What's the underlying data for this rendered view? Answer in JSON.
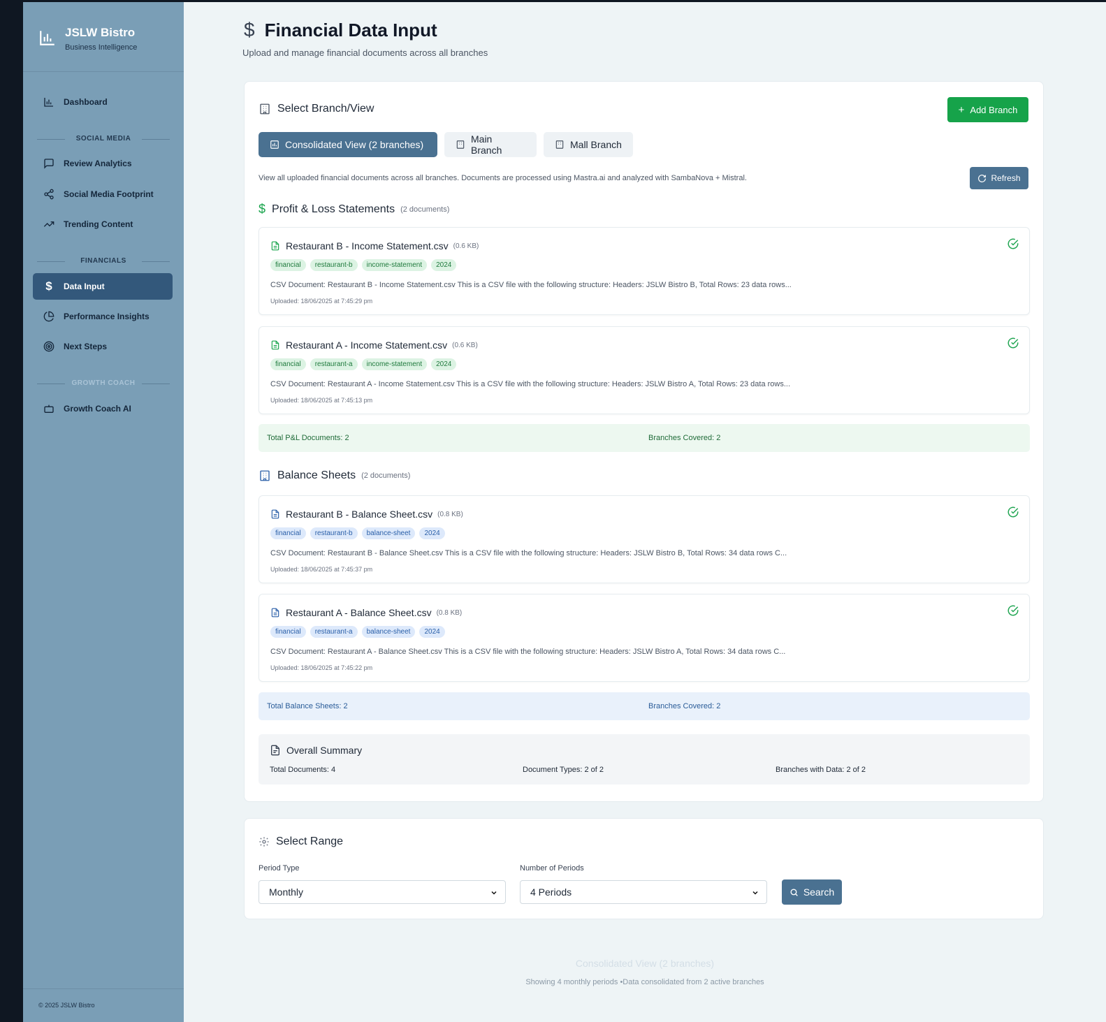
{
  "brand": {
    "title": "JSLW Bistro",
    "subtitle": "Business Intelligence"
  },
  "sidebar": {
    "dashboard": "Dashboard",
    "section_social": "SOCIAL MEDIA",
    "review_analytics": "Review Analytics",
    "social_footprint": "Social Media Footprint",
    "trending_content": "Trending Content",
    "section_financials": "FINANCIALS",
    "data_input": "Data Input",
    "performance_insights": "Performance Insights",
    "next_steps": "Next Steps",
    "section_growth": "GROWTH COACH",
    "growth_coach": "Growth Coach AI",
    "footer": "© 2025 JSLW Bistro"
  },
  "header": {
    "title": "Financial Data Input",
    "subtitle": "Upload and manage financial documents across all branches"
  },
  "branch": {
    "heading": "Select Branch/View",
    "add_button": "Add Branch",
    "tabs": [
      "Consolidated View (2 branches)",
      "Main Branch",
      "Mall Branch"
    ],
    "description": "View all uploaded financial documents across all branches. Documents are processed using Mastra.ai and analyzed with SambaNova + Mistral.",
    "refresh": "Refresh"
  },
  "pl": {
    "heading": "Profit & Loss Statements",
    "count": "(2 documents)",
    "docs": [
      {
        "name": "Restaurant B - Income Statement.csv",
        "size": "(0.6 KB)",
        "tags": [
          "financial",
          "restaurant-b",
          "income-statement",
          "2024"
        ],
        "desc": "CSV Document: Restaurant B - Income Statement.csv This is a CSV file with the following structure: Headers: JSLW Bistro B, Total Rows: 23 data rows...",
        "uploaded": "Uploaded: 18/06/2025 at 7:45:29 pm"
      },
      {
        "name": "Restaurant A - Income Statement.csv",
        "size": "(0.6 KB)",
        "tags": [
          "financial",
          "restaurant-a",
          "income-statement",
          "2024"
        ],
        "desc": "CSV Document: Restaurant A - Income Statement.csv This is a CSV file with the following structure: Headers: JSLW Bistro A, Total Rows: 23 data rows...",
        "uploaded": "Uploaded: 18/06/2025 at 7:45:13 pm"
      }
    ],
    "total": "Total P&L Documents: 2",
    "branches": "Branches Covered: 2"
  },
  "bs": {
    "heading": "Balance Sheets",
    "count": "(2 documents)",
    "docs": [
      {
        "name": "Restaurant B - Balance Sheet.csv",
        "size": "(0.8 KB)",
        "tags": [
          "financial",
          "restaurant-b",
          "balance-sheet",
          "2024"
        ],
        "desc": "CSV Document: Restaurant B - Balance Sheet.csv This is a CSV file with the following structure: Headers: JSLW Bistro B, Total Rows: 34 data rows C...",
        "uploaded": "Uploaded: 18/06/2025 at 7:45:37 pm"
      },
      {
        "name": "Restaurant A - Balance Sheet.csv",
        "size": "(0.8 KB)",
        "tags": [
          "financial",
          "restaurant-a",
          "balance-sheet",
          "2024"
        ],
        "desc": "CSV Document: Restaurant A - Balance Sheet.csv This is a CSV file with the following structure: Headers: JSLW Bistro A, Total Rows: 34 data rows C...",
        "uploaded": "Uploaded: 18/06/2025 at 7:45:22 pm"
      }
    ],
    "total": "Total Balance Sheets: 2",
    "branches": "Branches Covered: 2"
  },
  "overall": {
    "heading": "Overall Summary",
    "total_docs": "Total Documents: 4",
    "doc_types": "Document Types: 2 of 2",
    "branches_data": "Branches with Data: 2 of 2"
  },
  "range": {
    "heading": "Select Range",
    "period_type_label": "Period Type",
    "period_type_value": "Monthly",
    "num_periods_label": "Number of Periods",
    "num_periods_value": "4 Periods",
    "search": "Search"
  },
  "footer": {
    "line1": "Consolidated View (2 branches)",
    "line2": "Showing 4 monthly periods •Data consolidated from 2 active branches"
  },
  "colors": {
    "sidebar": "#7a9eb6",
    "active_nav": "#33587b",
    "accent": "#4a7191",
    "green": "#16a34a"
  }
}
